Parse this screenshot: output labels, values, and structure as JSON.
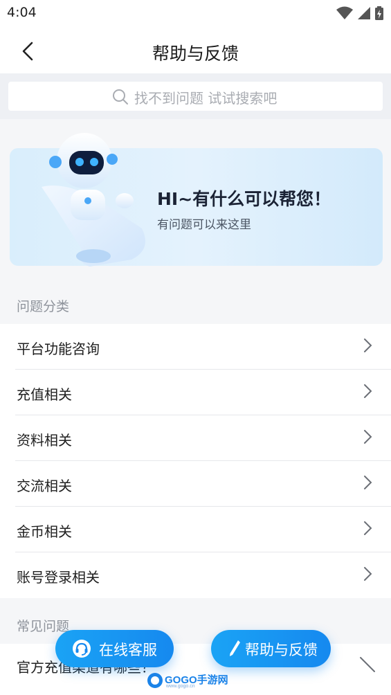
{
  "status_bar": {
    "time": "4:04"
  },
  "header": {
    "title": "帮助与反馈"
  },
  "search": {
    "placeholder": "找不到问题 试试搜索吧"
  },
  "banner": {
    "title": "HI~有什么可以帮您！",
    "subtitle": "有问题可以来这里"
  },
  "categories": {
    "section_title": "问题分类",
    "items": [
      {
        "label": "平台功能咨询"
      },
      {
        "label": "充值相关"
      },
      {
        "label": "资料相关"
      },
      {
        "label": "交流相关"
      },
      {
        "label": "金币相关"
      },
      {
        "label": "账号登录相关"
      }
    ]
  },
  "faq": {
    "section_title": "常见问题",
    "items": [
      {
        "label": "官方充值渠道有哪些？"
      }
    ]
  },
  "actions": {
    "online_service": "在线客服",
    "help_feedback": "帮助与反馈"
  },
  "watermark": {
    "text": "GOGO手游网",
    "url": "www.gogo.cn"
  },
  "colors": {
    "accent": "#1689ef",
    "background": "#f5f6f8"
  }
}
